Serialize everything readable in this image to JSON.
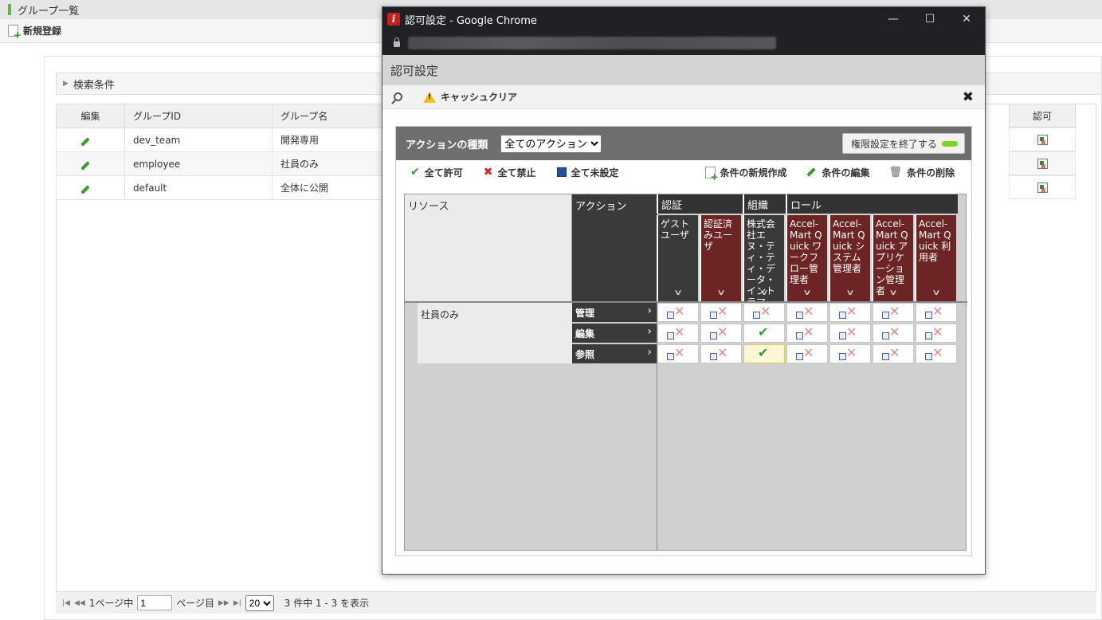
{
  "bg": {
    "title": "グループ一覧",
    "new_label": "新規登録",
    "search_label": "検索条件",
    "columns": [
      "編集",
      "グループID",
      "グループ名"
    ],
    "auth_header": "認可",
    "rows": [
      {
        "id": "dev_team",
        "name": "開発専用"
      },
      {
        "id": "employee",
        "name": "社員のみ"
      },
      {
        "id": "default",
        "name": "全体に公開"
      }
    ],
    "pager": {
      "page_prefix": "1ページ中",
      "page_value": "1",
      "page_suffix": "ページ目",
      "per_page": "20",
      "summary": "3 件中 1 - 3 を表示"
    }
  },
  "window": {
    "title": "認可設定 - Google Chrome",
    "logo": "i",
    "controls": [
      "minimize-icon",
      "maximize-icon",
      "close-icon"
    ]
  },
  "dialog": {
    "title": "認可設定",
    "cache_clear": "キャッシュクリア",
    "action_type_label": "アクションの種類",
    "action_select": "全てのアクション",
    "end_button": "権限設定を終了する",
    "tools": {
      "allow_all": "全て許可",
      "deny_all": "全て禁止",
      "unset_all": "全て未設定",
      "new_condition": "条件の新規作成",
      "edit_condition": "条件の編集",
      "delete_condition": "条件の削除"
    },
    "matrix": {
      "resource_header": "リソース",
      "action_header": "アクション",
      "groups": [
        "認証",
        "組織",
        "ロール"
      ],
      "columns": [
        "ゲストユーザ",
        "認証済みユーザ",
        "株式会社エヌ・ティ・ティ・データ・イントラマート",
        "Accel-Mart Quick ワークフロー管理者",
        "Accel-Mart Quick システム管理者",
        "Accel-Mart Quick アプリケーション管理者",
        "Accel-Mart Quick 利用者"
      ],
      "resource_name": "社員のみ",
      "actions": [
        "管理",
        "編集",
        "参照"
      ],
      "cells": [
        [
          "deny",
          "deny",
          "deny",
          "deny",
          "deny",
          "deny",
          "deny"
        ],
        [
          "deny",
          "deny",
          "allow",
          "deny",
          "deny",
          "deny",
          "deny"
        ],
        [
          "deny",
          "deny",
          "allow",
          "deny",
          "deny",
          "deny",
          "deny"
        ]
      ]
    }
  }
}
